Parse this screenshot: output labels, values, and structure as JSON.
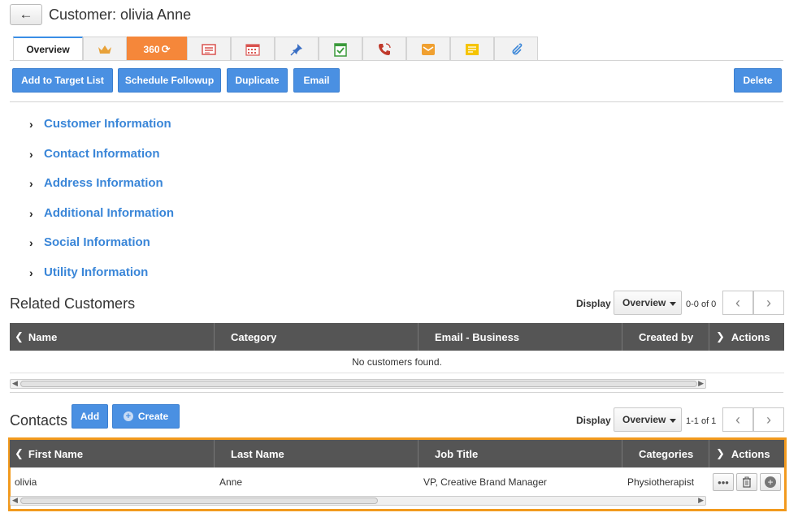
{
  "header": {
    "back_icon": "arrow-left-icon",
    "title": "Customer: olivia Anne"
  },
  "tabs": [
    {
      "label": "Overview",
      "icon": ""
    },
    {
      "label": "",
      "icon": "crown-icon",
      "color": "#e8a23a"
    },
    {
      "label": "360",
      "icon": "360-icon"
    },
    {
      "label": "",
      "icon": "contact-card-icon",
      "color": "#d9534f"
    },
    {
      "label": "",
      "icon": "calendar-icon",
      "color": "#d9534f"
    },
    {
      "label": "",
      "icon": "pin-icon",
      "color": "#3a6fc4"
    },
    {
      "label": "",
      "icon": "checklist-icon",
      "color": "#3a9a3a"
    },
    {
      "label": "",
      "icon": "phone-icon",
      "color": "#c0392b"
    },
    {
      "label": "",
      "icon": "mail-icon",
      "color": "#f0a030"
    },
    {
      "label": "",
      "icon": "note-icon",
      "color": "#f5c400"
    },
    {
      "label": "",
      "icon": "paperclip-icon",
      "color": "#3a86d8"
    }
  ],
  "actions": {
    "add_to_target_list": "Add to Target List",
    "schedule_followup": "Schedule Followup",
    "duplicate": "Duplicate",
    "email": "Email",
    "delete": "Delete"
  },
  "sections": [
    "Customer Information",
    "Contact Information",
    "Address Information",
    "Additional Information",
    "Social Information",
    "Utility Information"
  ],
  "related_customers": {
    "title": "Related Customers",
    "display_label": "Display",
    "display_value": "Overview",
    "pager": "0-0 of 0",
    "columns": [
      "Name",
      "Category",
      "Email - Business",
      "Created by",
      "Actions"
    ],
    "empty_message": "No customers found."
  },
  "contacts": {
    "title": "Contacts",
    "add_label": "Add",
    "create_label": "Create",
    "display_label": "Display",
    "display_value": "Overview",
    "pager": "1-1 of 1",
    "columns": [
      "First Name",
      "Last Name",
      "Job Title",
      "Categories",
      "Actions"
    ],
    "rows": [
      {
        "first_name": "olivia",
        "last_name": "Anne",
        "job_title": "VP, Creative Brand Manager",
        "categories": "Physiotherapist"
      }
    ]
  },
  "colors": {
    "accent": "#4a90e2",
    "link": "#3a86d8",
    "table_header": "#555555",
    "highlight": "#f29a1e",
    "tab_orange": "#f5873a"
  }
}
